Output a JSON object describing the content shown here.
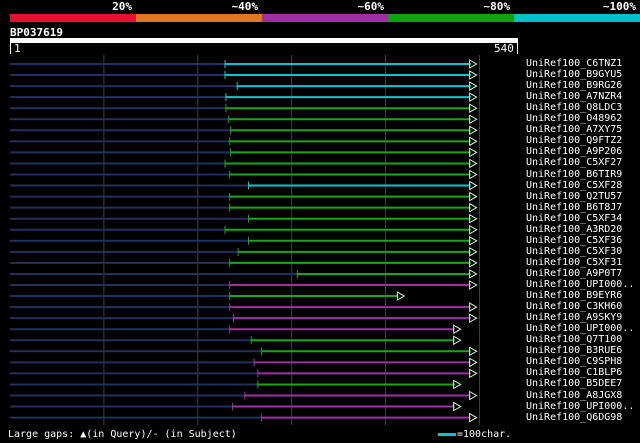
{
  "legend": {
    "labels": [
      "20%",
      "~40%",
      "~60%",
      "~80%",
      "~100%"
    ],
    "colors": [
      "#e8102f",
      "#e07820",
      "#a030a0",
      "#10a010",
      "#00c0c8"
    ]
  },
  "query": {
    "id": "BP037619",
    "start": "1",
    "end": "540",
    "length": 540
  },
  "footer": {
    "gaps": "Large gaps: ▲(in Query)/- (in Subject)",
    "scale": "=100char."
  },
  "hits": [
    {
      "name": "UniRef100_C6TNZ1",
      "start": 229,
      "end": 497,
      "color": "cyan"
    },
    {
      "name": "UniRef100_B9GYU5",
      "start": 229,
      "end": 497,
      "color": "cyan"
    },
    {
      "name": "UniRef100_B9RG26",
      "start": 242,
      "end": 497,
      "color": "cyan"
    },
    {
      "name": "UniRef100_A7NZR4",
      "start": 230,
      "end": 497,
      "color": "cyan"
    },
    {
      "name": "UniRef100_Q8LDC3",
      "start": 230,
      "end": 497,
      "color": "green"
    },
    {
      "name": "UniRef100_O48962",
      "start": 233,
      "end": 497,
      "color": "green"
    },
    {
      "name": "UniRef100_A7XY75",
      "start": 235,
      "end": 497,
      "color": "green"
    },
    {
      "name": "UniRef100_Q9FTZ2",
      "start": 234,
      "end": 497,
      "color": "green"
    },
    {
      "name": "UniRef100_A9P206",
      "start": 235,
      "end": 497,
      "color": "green"
    },
    {
      "name": "UniRef100_C5XF27",
      "start": 229,
      "end": 497,
      "color": "green"
    },
    {
      "name": "UniRef100_B6TIR9",
      "start": 234,
      "end": 497,
      "color": "green"
    },
    {
      "name": "UniRef100_C5XF28",
      "start": 254,
      "end": 497,
      "color": "cyan"
    },
    {
      "name": "UniRef100_Q2TU57",
      "start": 234,
      "end": 497,
      "color": "green"
    },
    {
      "name": "UniRef100_B6T8J7",
      "start": 234,
      "end": 497,
      "color": "green"
    },
    {
      "name": "UniRef100_C5XF34",
      "start": 254,
      "end": 497,
      "color": "green"
    },
    {
      "name": "UniRef100_A3RD20",
      "start": 229,
      "end": 497,
      "color": "green"
    },
    {
      "name": "UniRef100_C5XF36",
      "start": 254,
      "end": 497,
      "color": "green"
    },
    {
      "name": "UniRef100_C5XF30",
      "start": 243,
      "end": 497,
      "color": "green"
    },
    {
      "name": "UniRef100_C5XF31",
      "start": 234,
      "end": 497,
      "color": "green"
    },
    {
      "name": "UniRef100_A9P0T7",
      "start": 306,
      "end": 497,
      "color": "green"
    },
    {
      "name": "UniRef100_UPI000..",
      "start": 234,
      "end": 497,
      "color": "purple"
    },
    {
      "name": "UniRef100_B9EYR6",
      "start": 234,
      "end": 420,
      "color": "green"
    },
    {
      "name": "UniRef100_C3KH60",
      "start": 234,
      "end": 497,
      "color": "purple"
    },
    {
      "name": "UniRef100_A9SKY9",
      "start": 238,
      "end": 497,
      "color": "purple"
    },
    {
      "name": "UniRef100_UPI000..",
      "start": 234,
      "end": 480,
      "color": "purple"
    },
    {
      "name": "UniRef100_Q7T100",
      "start": 257,
      "end": 480,
      "color": "green"
    },
    {
      "name": "UniRef100_B3RUE6",
      "start": 268,
      "end": 497,
      "color": "green"
    },
    {
      "name": "UniRef100_C9SPH8",
      "start": 260,
      "end": 497,
      "color": "purple"
    },
    {
      "name": "UniRef100_C1BLP6",
      "start": 264,
      "end": 497,
      "color": "purple"
    },
    {
      "name": "UniRef100_B5DEE7",
      "start": 264,
      "end": 480,
      "color": "green"
    },
    {
      "name": "UniRef100_A8JGX8",
      "start": 250,
      "end": 497,
      "color": "purple"
    },
    {
      "name": "UniRef100_UPI000..",
      "start": 237,
      "end": 480,
      "color": "purple"
    },
    {
      "name": "UniRef100_Q6DG98",
      "start": 268,
      "end": 497,
      "color": "purple"
    }
  ],
  "colors": {
    "cyan": "#00c8d0",
    "green": "#18a818",
    "purple": "#a030a8",
    "guide": "#203060",
    "grid": "#404040"
  }
}
